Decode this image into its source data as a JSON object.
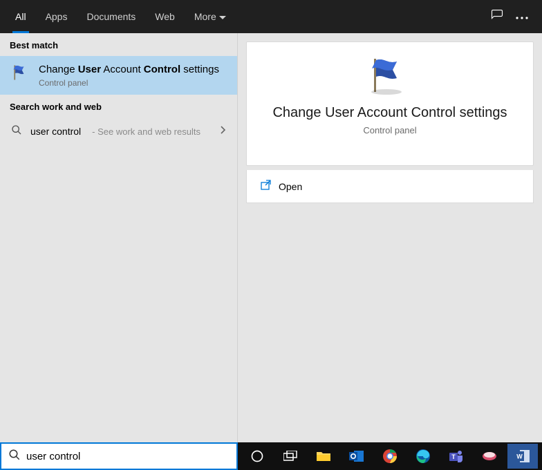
{
  "tabs": {
    "all": "All",
    "apps": "Apps",
    "documents": "Documents",
    "web": "Web",
    "more": "More"
  },
  "sections": {
    "best_match": "Best match",
    "work_web": "Search work and web"
  },
  "best_match_result": {
    "title_pre": "Change ",
    "title_b1": "User",
    "title_mid": " Account ",
    "title_b2": "Control",
    "title_post": " settings",
    "subtitle": "Control panel"
  },
  "web_result": {
    "query": "user control",
    "hint": " - See work and web results"
  },
  "detail": {
    "title": "Change User Account Control settings",
    "subtitle": "Control panel",
    "open": "Open"
  },
  "search": {
    "value": "user control"
  },
  "icons": {
    "feedback": "feedback",
    "more": "more",
    "cortana": "cortana",
    "taskview": "taskview",
    "explorer": "explorer",
    "outlook": "outlook",
    "chrome": "chrome",
    "edge": "edge",
    "teams": "teams",
    "snip": "snip",
    "word": "word"
  }
}
